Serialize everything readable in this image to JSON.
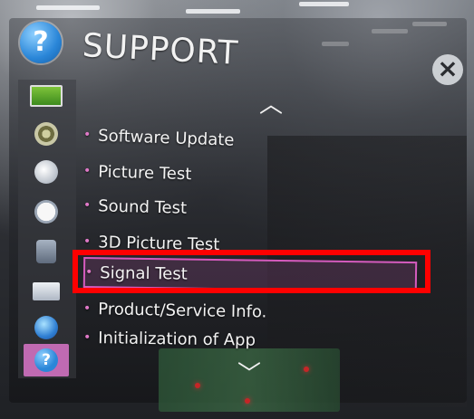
{
  "header": {
    "title": "SUPPORT",
    "icon_glyph": "?"
  },
  "close_button": {
    "glyph": "×"
  },
  "sidebar": {
    "items": [
      {
        "name": "picture-icon"
      },
      {
        "name": "speaker-icon"
      },
      {
        "name": "satellite-icon"
      },
      {
        "name": "clock-icon"
      },
      {
        "name": "lock-icon"
      },
      {
        "name": "mail-icon"
      },
      {
        "name": "globe-icon"
      },
      {
        "name": "help-icon",
        "glyph": "?",
        "active": true
      }
    ]
  },
  "menu": {
    "scroll_up_glyph": "︿",
    "scroll_down_glyph": "﹀",
    "items": [
      {
        "label": "Software Update"
      },
      {
        "label": "Picture Test"
      },
      {
        "label": "Sound Test"
      },
      {
        "label": "3D Picture Test"
      },
      {
        "label": "Signal Test",
        "selected": true
      },
      {
        "label": "Product/Service Info."
      },
      {
        "label": "Initialization of App"
      }
    ],
    "bullet": "•"
  },
  "colors": {
    "accent": "#d45bbd",
    "highlight_frame": "#ff0000",
    "active_sidebar": "#c06ab2"
  }
}
